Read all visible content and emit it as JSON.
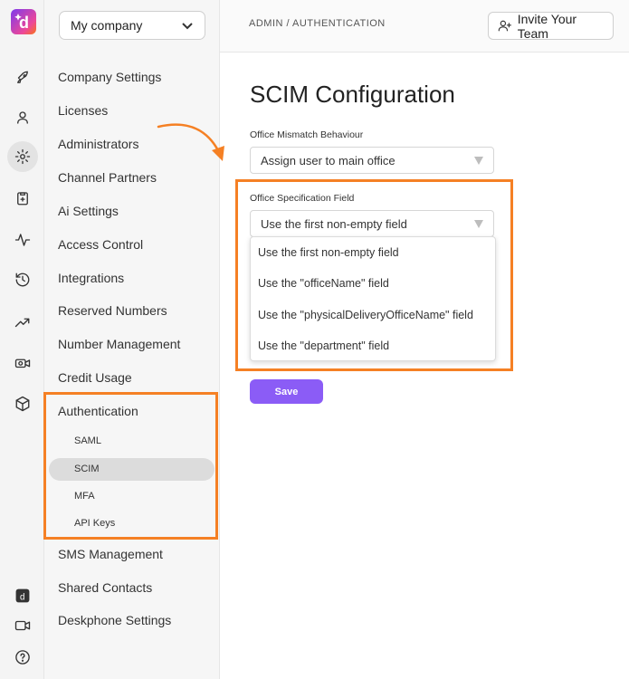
{
  "header": {
    "breadcrumb": "ADMIN / AUTHENTICATION",
    "invite_label": "Invite Your Team"
  },
  "company_selector": {
    "value": "My company"
  },
  "rail_icons": [
    "logo-icon",
    "rocket-icon",
    "user-icon",
    "gear-icon",
    "clipboard-icon",
    "activity-icon",
    "history-icon",
    "trending-icon",
    "camera-icon",
    "cube-icon",
    "app-icon",
    "video-icon",
    "help-icon"
  ],
  "sidebar": {
    "items": [
      {
        "label": "Company Settings"
      },
      {
        "label": "Licenses"
      },
      {
        "label": "Administrators"
      },
      {
        "label": "Channel Partners"
      },
      {
        "label": "Ai Settings"
      },
      {
        "label": "Access Control"
      },
      {
        "label": "Integrations"
      },
      {
        "label": "Reserved Numbers"
      },
      {
        "label": "Number Management"
      },
      {
        "label": "Credit Usage"
      },
      {
        "label": "Authentication"
      },
      {
        "label": "SMS Management"
      },
      {
        "label": "Shared Contacts"
      },
      {
        "label": "Deskphone Settings"
      }
    ],
    "sub_items": [
      {
        "label": "SAML"
      },
      {
        "label": "SCIM",
        "active": true
      },
      {
        "label": "MFA"
      },
      {
        "label": "API Keys"
      }
    ]
  },
  "main": {
    "title": "SCIM Configuration",
    "mismatch": {
      "label": "Office Mismatch Behaviour",
      "value": "Assign user to main office"
    },
    "spec": {
      "label": "Office Specification Field",
      "value": "Use the first non-empty field",
      "options": [
        "Use the first non-empty field",
        "Use the \"officeName\" field",
        "Use the \"physicalDeliveryOfficeName\" field",
        "Use the \"department\" field"
      ]
    },
    "save_label": "Save"
  },
  "colors": {
    "accent": "#8b5cf6",
    "highlight": "#f58024"
  }
}
